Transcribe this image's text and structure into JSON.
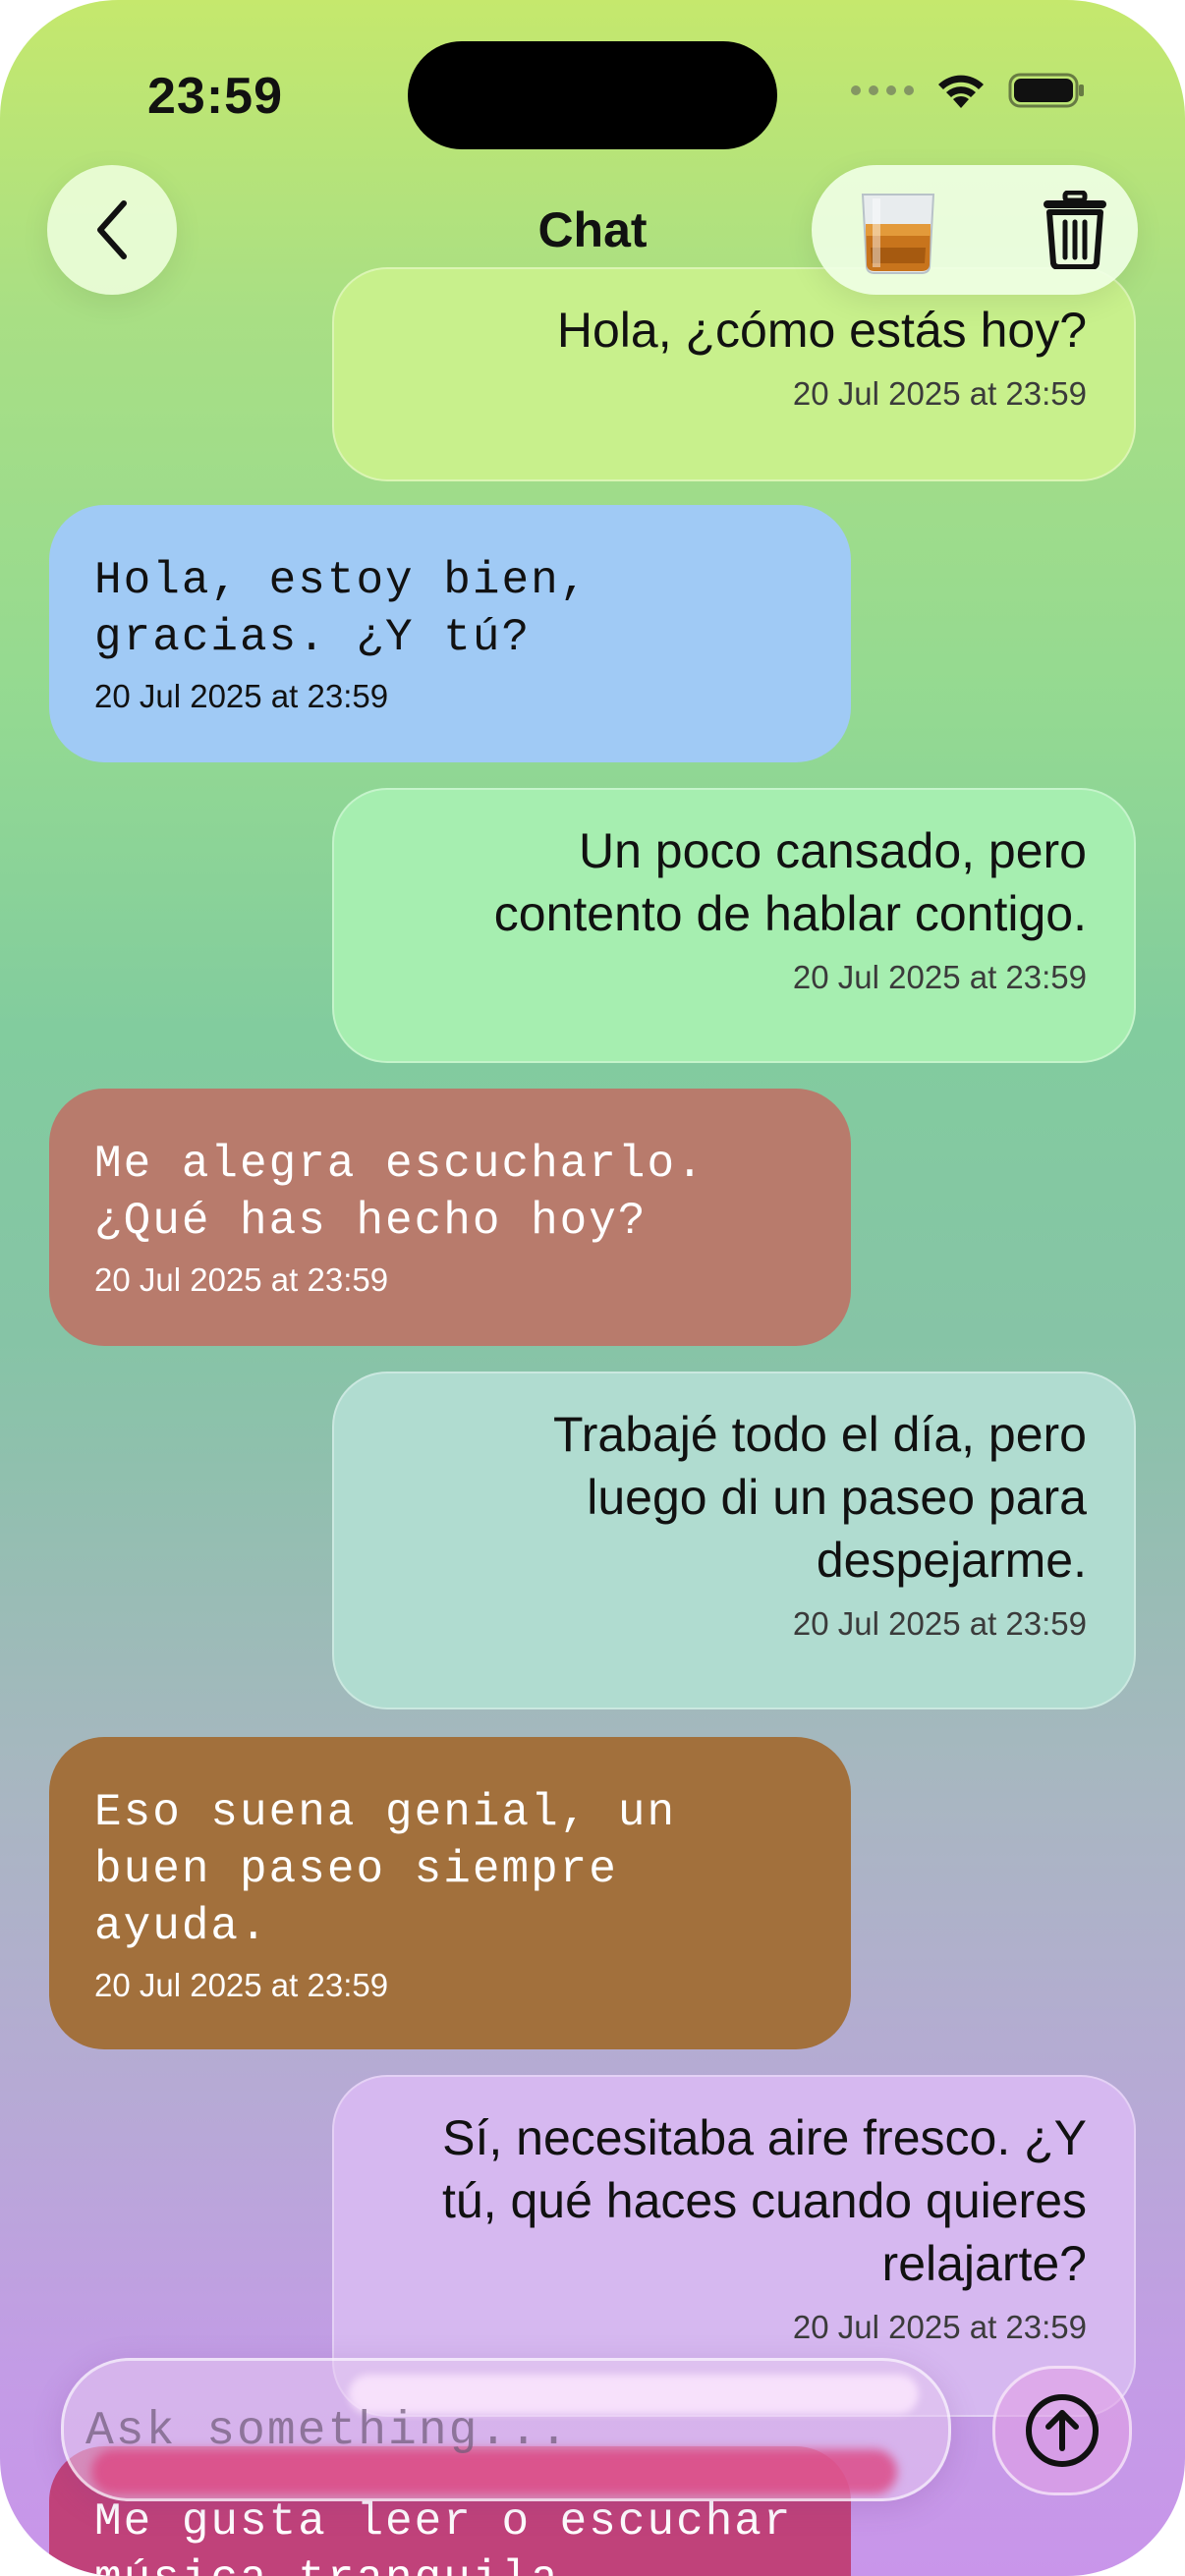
{
  "status_bar": {
    "time": "23:59"
  },
  "nav": {
    "title": "Chat"
  },
  "messages": [
    {
      "sender": "me",
      "text": "Hola, ¿cómo estás hoy?",
      "timestamp": "20 Jul 2025 at 23:59",
      "color": "#c8f08c"
    },
    {
      "sender": "bot",
      "text": "Hola, estoy bien,\ngracias. ¿Y tú?",
      "timestamp": "20 Jul 2025 at 23:59",
      "color": "#a0caf5",
      "text_color": "#111111"
    },
    {
      "sender": "me",
      "text": "Un poco cansado, pero\ncontento de hablar contigo.",
      "timestamp": "20 Jul 2025 at 23:59",
      "color": "#a6eeb0"
    },
    {
      "sender": "bot",
      "text": "Me alegra escucharlo.\n¿Qué has hecho hoy?",
      "timestamp": "20 Jul 2025 at 23:59",
      "color": "#b87b6c",
      "text_color": "#ffffff"
    },
    {
      "sender": "me",
      "text": "Trabajé todo el día, pero\nluego di un paseo para\ndespejarme.",
      "timestamp": "20 Jul 2025 at 23:59",
      "color": "#b0dcd0"
    },
    {
      "sender": "bot",
      "text": "Eso suena genial, un\nbuen paseo siempre\nayuda.",
      "timestamp": "20 Jul 2025 at 23:59",
      "color": "#a2703c",
      "text_color": "#ffffff"
    },
    {
      "sender": "me",
      "text": "Sí, necesitaba aire fresco. ¿Y\ntú, qué haces cuando quieres\nrelajarte?",
      "timestamp": "20 Jul 2025 at 23:59",
      "color": "#d6b8f0"
    },
    {
      "sender": "bot",
      "text": "Me gusta leer o escuchar\nmúsica tranquila.",
      "timestamp": "",
      "color": "#c0427a",
      "text_color": "#ffffff"
    }
  ],
  "composer": {
    "placeholder": "Ask something..."
  }
}
